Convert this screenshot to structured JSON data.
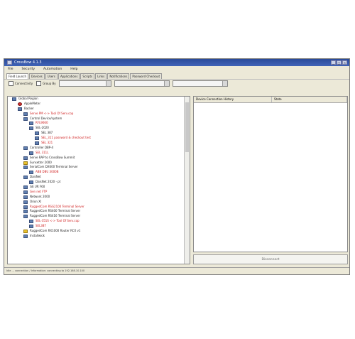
{
  "window": {
    "title": "CrossBow 4.1.3"
  },
  "menu": [
    "File",
    "Security",
    "Automation",
    "Help"
  ],
  "tabs": [
    "Field Launch",
    "Devices",
    "Users",
    "Applications",
    "Scripts",
    "Links",
    "Notifications",
    "Password Checkout"
  ],
  "toolbar": {
    "connectivity_label": "Connectivity",
    "group_by_label": "Group By"
  },
  "tree": [
    {
      "indent": 0,
      "icon": "folder",
      "text": "Global Region",
      "red": false
    },
    {
      "indent": 1,
      "icon": "error",
      "text": "AppleMeter",
      "red": false
    },
    {
      "indent": 1,
      "icon": "folder",
      "text": "Backer",
      "red": false
    },
    {
      "indent": 2,
      "icon": "device",
      "text": "Serve PM <-> Tool Of Serv.cop",
      "red": true
    },
    {
      "indent": 2,
      "icon": "folder",
      "text": "Control Device/system",
      "red": false
    },
    {
      "indent": 3,
      "icon": "device",
      "text": "RFL9660",
      "red": true
    },
    {
      "indent": 3,
      "icon": "folder",
      "text": "SEL-2020",
      "red": false
    },
    {
      "indent": 4,
      "icon": "device",
      "text": "SEL 387",
      "red": false
    },
    {
      "indent": 4,
      "icon": "device",
      "text": "SEL_311 password & checkout test",
      "red": true
    },
    {
      "indent": 4,
      "icon": "device",
      "text": "SEL 321",
      "red": true
    },
    {
      "indent": 2,
      "icon": "folder",
      "text": "Controller DBP-4",
      "red": false
    },
    {
      "indent": 3,
      "icon": "device",
      "text": "SEL 311L",
      "red": true
    },
    {
      "indent": 2,
      "icon": "device",
      "text": "Serve RAP to CrossBow Summit",
      "red": false
    },
    {
      "indent": 2,
      "icon": "warning",
      "text": "Sunsetter 2000",
      "red": false
    },
    {
      "indent": 2,
      "icon": "folder",
      "text": "SerialCom DX600 Terminal Server",
      "red": false
    },
    {
      "indent": 3,
      "icon": "device",
      "text": "ABB DBU 3000B",
      "red": true
    },
    {
      "indent": 2,
      "icon": "folder",
      "text": "DaisNet",
      "red": false
    },
    {
      "indent": 3,
      "icon": "device",
      "text": "DaisNet 2020 - pt",
      "red": false
    },
    {
      "indent": 2,
      "icon": "device",
      "text": "GE UR F60",
      "red": false
    },
    {
      "indent": 2,
      "icon": "device",
      "text": "Gen net FTP",
      "red": true
    },
    {
      "indent": 2,
      "icon": "device",
      "text": "Network 2000",
      "red": false
    },
    {
      "indent": 2,
      "icon": "device",
      "text": "Orion XI",
      "red": false
    },
    {
      "indent": 2,
      "icon": "device",
      "text": "RuggedCom RSG2100 Terminal Server",
      "red": true
    },
    {
      "indent": 2,
      "icon": "device",
      "text": "RuggedCom RS400 Terminal Server",
      "red": false
    },
    {
      "indent": 2,
      "icon": "folder",
      "text": "RuggedCom RS416 Terminal Server",
      "red": false
    },
    {
      "indent": 3,
      "icon": "device",
      "text": "SEL-351S <-> Tool Of Serv.cop",
      "red": true
    },
    {
      "indent": 3,
      "icon": "device",
      "text": "SEL387",
      "red": true
    },
    {
      "indent": 2,
      "icon": "warning",
      "text": "RuggedCom RX1000 Router RCX v1",
      "red": false
    },
    {
      "indent": 2,
      "icon": "device",
      "text": "Installwick",
      "red": false
    }
  ],
  "right_pane": {
    "col1": "Device Connection History",
    "col2": "State"
  },
  "disconnect_label": "Disconnect",
  "status_text": "Idle   ... connection / Information: connecting to 192.168.10.100"
}
